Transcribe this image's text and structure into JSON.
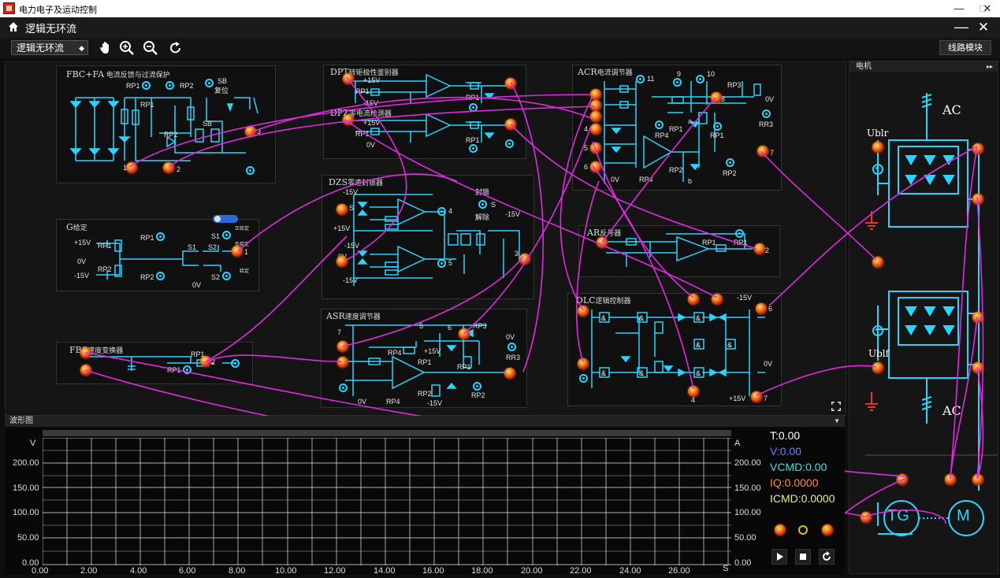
{
  "window": {
    "title": "电力电子及运动控制",
    "min_label": "—",
    "max_label": "□",
    "close_label": "✕"
  },
  "app": {
    "title": "逻辑无环流",
    "minimize_label": "—",
    "close_label": "✕"
  },
  "toolbar": {
    "mode_value": "逻辑无环流",
    "module_button": "线路模块",
    "tools": [
      "hand-icon",
      "zoom-in-icon",
      "zoom-out-icon",
      "reset-icon"
    ]
  },
  "panels": {
    "fbc": {
      "title": "FBC+FA",
      "subtitle": "电流反馈与过流保护",
      "rp1": "RP1",
      "rp2": "RP2",
      "sb": "SB",
      "reset": "复位",
      "rp1b": "RP1",
      "rp2b": "RP2",
      "sb2": "SB",
      "p1": "1",
      "p2": "2",
      "p3": "3"
    },
    "g": {
      "title": "G",
      "subtitle": "给定",
      "p15": "+15V",
      "n15": "-15V",
      "zero": "0V",
      "zero2": "0V",
      "rp1": "RP1",
      "rp2": "RP2",
      "rp1b": "RP1",
      "rp2b": "RP2",
      "s1": "S1",
      "s2": "S2",
      "s1b": "S1",
      "s2b": "S2",
      "s1note": "正给定",
      "s2note": "负给定",
      "note": "给定",
      "p1": "1"
    },
    "fbs": {
      "title": "FBS",
      "subtitle": "速度变换器",
      "rp1": "RP1",
      "rp1b": "RP1",
      "p2": "2"
    },
    "dpt": {
      "title": "DPT",
      "subtitle": "转矩极性鉴别器",
      "p15": "+15V",
      "n15": "-15V",
      "rp1": "RP1",
      "rp1b": "RP1"
    },
    "dpz": {
      "title": "DPZ",
      "subtitle": "零电流检测器",
      "p15": "+15V",
      "zero": "0V",
      "rp1": "RP1",
      "rp1b": "RP1"
    },
    "dzs": {
      "title": "DZS",
      "subtitle": "零速封锁器",
      "n15": "-15V",
      "p15": "+15V",
      "n15b": "-15V",
      "zero": "0V",
      "n15c": "-15V",
      "n15d": "-15V",
      "lock": "封锁",
      "unlock": "解除",
      "s": "S",
      "s2": "S",
      "p4": "4",
      "p5": "5",
      "p3": "3"
    },
    "asr": {
      "title": "ASR",
      "subtitle": "速度调节器",
      "p7": "7",
      "p5": "5",
      "p6": "6",
      "rp3": "RP3",
      "rp4": "RP4",
      "p15": "+15V",
      "rp1": "RP1",
      "rp1b": "RP1",
      "rp2": "RP2",
      "rp2b": "RP2",
      "n15": "-15V",
      "zero": "0V",
      "zero2": "0V",
      "rr3": "RR3",
      "p1": "1",
      "p2": "2",
      "p3": "3",
      "p4": "4"
    },
    "acr": {
      "title": "ACR",
      "subtitle": "电流调节器",
      "p11": "11",
      "p9": "9",
      "p10": "10",
      "p8": "8",
      "p7": "7",
      "p4": "4",
      "p5": "5",
      "p6": "6",
      "rp3": "RP3",
      "rp4": "RP4",
      "rp4b": "RP4",
      "rp1": "RP1",
      "rp1b": "RP1",
      "rp2": "RP2",
      "rp2b": "RP2",
      "zero": "0V",
      "zero2": "0V",
      "rr3": "RR3",
      "a": "a",
      "b": "b"
    },
    "ar": {
      "title": "AR",
      "subtitle": "反号器",
      "rp1": "RP1",
      "rp1b": "RP1",
      "p2": "2"
    },
    "dlc": {
      "title": "DLC",
      "subtitle": "逻辑控制器",
      "n15": "-15V",
      "p15": "+15V",
      "zero": "0V",
      "p6": "6",
      "p7": "7",
      "p4": "4"
    }
  },
  "motor": {
    "header": "电机",
    "ac_top": "AC",
    "ac_bottom": "AC",
    "ublr": "Ublr",
    "ublf": "Ublf",
    "tg": "TG",
    "m": "M"
  },
  "wave": {
    "header": "波形图",
    "y_unit_left": "V",
    "y_unit_right": "A",
    "x_unit": "S",
    "y_ticks": [
      "200.00",
      "150.00",
      "100.00",
      "50.00",
      "0.00"
    ],
    "y_ticks_right": [
      "200.00",
      "150.00",
      "100.00",
      "50.00",
      "0.00"
    ],
    "x_ticks": [
      "0.00",
      "2.00",
      "4.00",
      "6.00",
      "8.00",
      "10.00",
      "12.00",
      "14.00",
      "16.00",
      "18.00",
      "20.00",
      "22.00",
      "24.00",
      "26.00"
    ],
    "readouts": {
      "t": "T:0.00",
      "v": "V:0.00",
      "vcmd": "VCMD:0.00",
      "iq": "IQ:0.0000",
      "icmd": "ICMD:0.0000"
    },
    "colors": {
      "t": "#ffffff",
      "v": "#6f7dff",
      "vcmd": "#3fe0e0",
      "iq": "#ff8a3a",
      "icmd": "#e8e8a0"
    }
  }
}
